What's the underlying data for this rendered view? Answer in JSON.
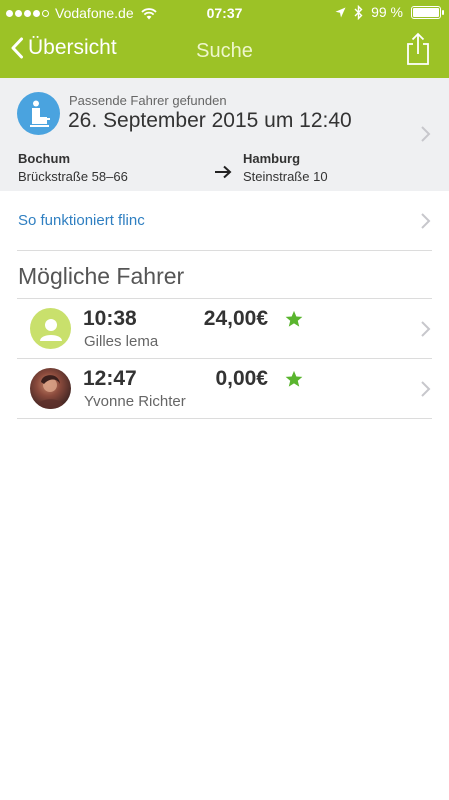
{
  "status_bar": {
    "carrier": "Vodafone.de",
    "time": "07:37",
    "battery": "99 %",
    "battery_level": 0.99,
    "signal_bars_filled": 4,
    "signal_bars_total": 5,
    "icons": [
      "wifi-icon",
      "location-arrow-icon",
      "bluetooth-icon",
      "battery-icon"
    ]
  },
  "nav": {
    "back_label": "Übersicht",
    "title": "Suche",
    "share_icon": "share-icon"
  },
  "summary": {
    "subtitle": "Passende Fahrer gefunden",
    "date": "26. September 2015 um 12:40",
    "from": {
      "city": "Bochum",
      "street": "Brückstraße 58–66"
    },
    "to": {
      "city": "Hamburg",
      "street": "Steinstraße 10"
    }
  },
  "howto": {
    "label": "So funktioniert flinc"
  },
  "drivers_section": {
    "title": "Mögliche Fahrer",
    "drivers": [
      {
        "time": "10:38",
        "price": "24,00€",
        "name": "Gilles lema",
        "avatar": "default-avatar-icon",
        "starred": true
      },
      {
        "time": "12:47",
        "price": "0,00€",
        "name": "Yvonne Richter",
        "avatar": "photo-avatar",
        "starred": true
      }
    ]
  },
  "colors": {
    "brand_green": "#9cc226",
    "summary_bg": "#eff0f2",
    "link_blue": "#2f7fc1",
    "star_green": "#5ab52e",
    "icon_blue": "#4aa3df"
  }
}
